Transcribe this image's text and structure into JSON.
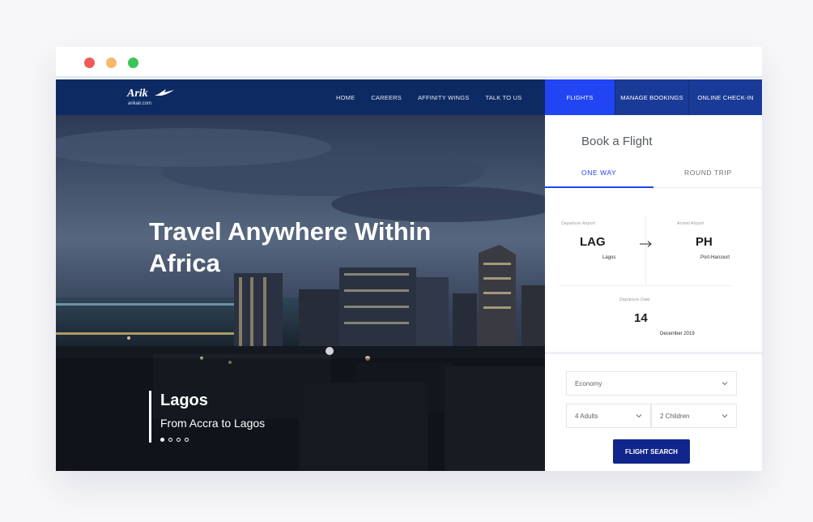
{
  "nav": {
    "logo": {
      "word": "Arik",
      "sub": "arikair.com"
    },
    "links": [
      "HOME",
      "CAREERS",
      "AFFINITY WINGS",
      "TALK TO US"
    ],
    "tabs": {
      "flights": "FLIGHTS",
      "manage": "MANAGE BOOKINGS",
      "checkin": "ONLINE CHECK-IN"
    }
  },
  "hero": {
    "title": "Travel Anywhere Within Africa",
    "city": "Lagos",
    "route": "From Accra to Lagos",
    "slides": 4,
    "active_slide": 1
  },
  "booking": {
    "title": "Book a Flight",
    "tabs": {
      "one_way": "ONE WAY",
      "round_trip": "ROUND TRIP"
    },
    "departure": {
      "label": "Departure Airport",
      "code": "LAG",
      "city": "Lagos"
    },
    "arrival": {
      "label": "Arrival Airport",
      "code": "PH",
      "city": "Port-Harcourt"
    },
    "date": {
      "label": "Departure Date",
      "day": "14",
      "month_year": "December 2019"
    },
    "cabin": "Economy",
    "adults": "4 Adults",
    "children": "2 Children",
    "search_label": "FLIGHT SEARCH"
  },
  "colors": {
    "nav_bg": "#0d2a63",
    "accent": "#2145f3",
    "button": "#12258c"
  }
}
